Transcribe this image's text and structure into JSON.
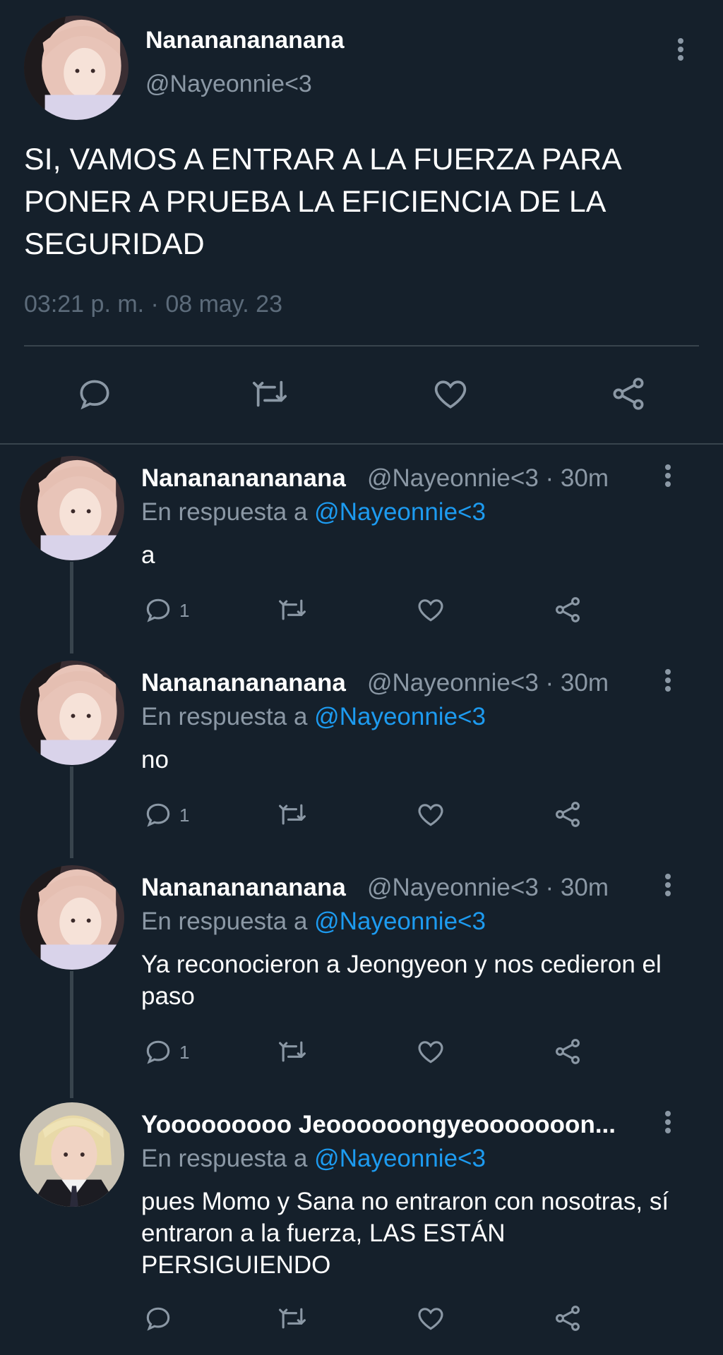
{
  "main_tweet": {
    "display_name": "Nanananananana",
    "handle": "@Nayeonnie<3",
    "text": "SI, VAMOS A ENTRAR A LA FUERZA PARA PONER A PRUEBA LA EFICIENCIA DE LA SEGURIDAD",
    "timestamp": "03:21 p. m. · 08 may. 23",
    "actions": [
      "reply-icon",
      "retweet-icon",
      "like-icon",
      "share-icon"
    ]
  },
  "replies": [
    {
      "display_name": "Nanananananana",
      "meta": "@Nayeonnie<3 · 30m",
      "reply_prefix": "En respuesta a",
      "reply_to": "@Nayeonnie<3",
      "text": "a",
      "reply_count": "1"
    },
    {
      "display_name": "Nanananananana",
      "meta": "@Nayeonnie<3 · 30m",
      "reply_prefix": "En respuesta a",
      "reply_to": "@Nayeonnie<3",
      "text": "no",
      "reply_count": "1"
    },
    {
      "display_name": "Nanananananana",
      "meta": "@Nayeonnie<3 · 30m",
      "reply_prefix": "En respuesta a",
      "reply_to": "@Nayeonnie<3",
      "text": "Ya reconocieron a Jeongyeon y nos cedieron el paso",
      "reply_count": "1"
    },
    {
      "display_name": "Yooooooooo Jeoooooongyeooooooon...",
      "meta": "",
      "reply_prefix": "En respuesta a",
      "reply_to": "@Nayeonnie<3",
      "text": "pues Momo y Sana no entraron con nosotras, sí entraron a la fuerza, LAS ESTÁN PERSIGUIENDO",
      "reply_count": ""
    }
  ],
  "colors": {
    "background": "#15202b",
    "secondary_text": "#8b98a5",
    "mention": "#1d9bf0",
    "divider": "#38444d"
  }
}
